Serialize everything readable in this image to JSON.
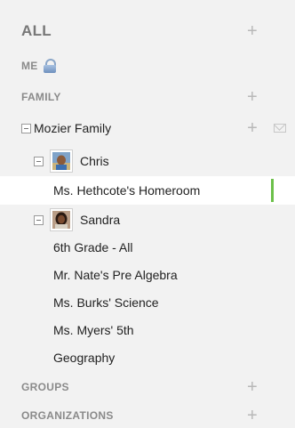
{
  "sections": {
    "all": "ALL",
    "me": "ME",
    "family": "FAMILY",
    "groups": "GROUPS",
    "organizations": "ORGANIZATIONS"
  },
  "plus_glyph": "+",
  "family_group": {
    "name": "Mozier Family"
  },
  "children": [
    {
      "name": "Chris",
      "classes": [
        "Ms. Hethcote's Homeroom"
      ]
    },
    {
      "name": "Sandra",
      "classes": [
        "6th Grade - All",
        "Mr. Nate's Pre Algebra",
        "Ms. Burks' Science",
        "Ms. Myers' 5th",
        "Geography"
      ]
    }
  ],
  "colors": {
    "selected_indicator": "#6cc04a",
    "section_text": "#8a8a8a",
    "background": "#f2f2f2"
  },
  "icons": {
    "me": "lock-icon",
    "add": "plus-icon",
    "message": "envelope-icon",
    "collapse": "minus-square-icon"
  }
}
